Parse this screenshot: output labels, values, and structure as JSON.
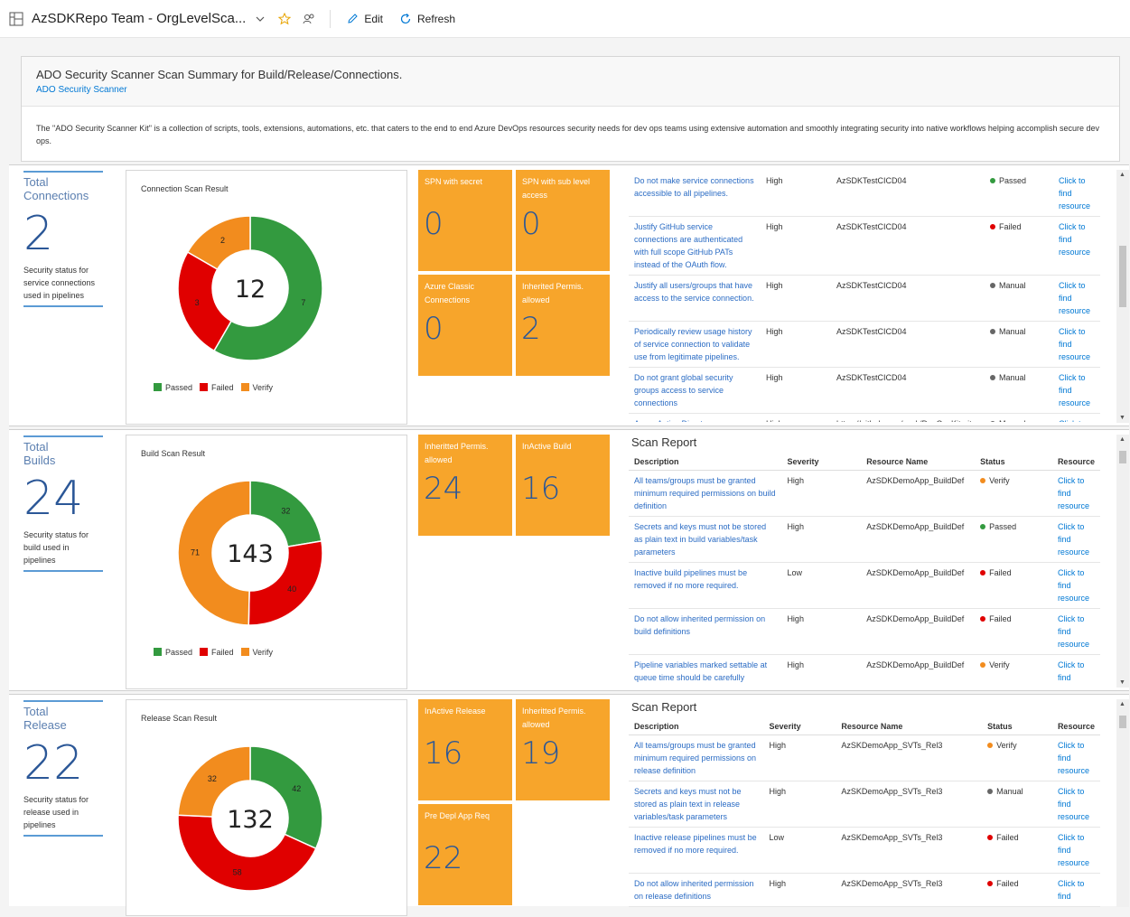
{
  "topbar": {
    "title": "AzSDKRepo Team - OrgLevelSca...",
    "edit_label": "Edit",
    "refresh_label": "Refresh"
  },
  "header": {
    "title": "ADO Security Scanner Scan Summary for Build/Release/Connections.",
    "link": "ADO Security Scanner",
    "description": "The \"ADO Security Scanner Kit\" is a collection of scripts, tools, extensions, automations, etc. that caters to the end to end Azure DevOps resources security needs for dev ops teams using extensive automation and smoothly integrating security into native workflows helping accomplish secure dev ops."
  },
  "colors": {
    "passed": "#339a3f",
    "failed": "#e00000",
    "verify": "#f28c1e",
    "manual": "#666666",
    "tile": "#f7a52b",
    "accent": "#2b5797"
  },
  "legend": {
    "passed": "Passed",
    "failed": "Failed",
    "verify": "Verify"
  },
  "connections": {
    "total_label_1": "Total",
    "total_label_2": "Connections",
    "total": "2",
    "sub": "Security status for service connections used in pipelines",
    "chart_title": "Connection Scan Result",
    "tiles": [
      {
        "label": "SPN with secret",
        "value": "0"
      },
      {
        "label": "SPN with sub level access",
        "value": "0"
      },
      {
        "label": "Azure Classic Connections",
        "value": "0"
      },
      {
        "label": "Inherited Permis. allowed",
        "value": "2"
      }
    ],
    "rows": [
      {
        "desc": "Do not make service connections accessible to all pipelines.",
        "severity": "High",
        "resource": "AzSDKTestCICD04",
        "status": "Passed",
        "status_color": "#339a3f",
        "link": "Click to find resource"
      },
      {
        "desc": "Justify GitHub service connections are authenticated with full scope GitHub PATs instead of the OAuth flow.",
        "severity": "High",
        "resource": "AzSDKTestCICD04",
        "status": "Failed",
        "status_color": "#e00000",
        "link": "Click to find resource"
      },
      {
        "desc": "Justify all users/groups that have access to the service connection.",
        "severity": "High",
        "resource": "AzSDKTestCICD04",
        "status": "Manual",
        "status_color": "#666666",
        "link": "Click to find resource"
      },
      {
        "desc": "Periodically review usage history of service connection to validate use from legitimate pipelines.",
        "severity": "High",
        "resource": "AzSDKTestCICD04",
        "status": "Manual",
        "status_color": "#666666",
        "link": "Click to find resource"
      },
      {
        "desc": "Do not grant global security groups access to service connections",
        "severity": "High",
        "resource": "AzSDKTestCICD04",
        "status": "Manual",
        "status_color": "#666666",
        "link": "Click to find resource"
      },
      {
        "desc": "Azure Active Directory",
        "severity": "High",
        "resource": "https://github.com/azsk/DevOpsKit.git",
        "status": "Manual",
        "status_color": "#666666",
        "link": "Click to"
      }
    ]
  },
  "builds": {
    "total_label_1": "Total",
    "total_label_2": "Builds",
    "total": "24",
    "sub": "Security status for build used in pipelines",
    "chart_title": "Build Scan Result",
    "tiles": [
      {
        "label": "Inheritted Permis. allowed",
        "value": "24"
      },
      {
        "label": "InActive Build",
        "value": "16"
      }
    ],
    "report_title": "Scan Report",
    "headers": [
      "Description",
      "Severity",
      "Resource Name",
      "Status",
      "Resource"
    ],
    "rows": [
      {
        "desc": "All teams/groups must be granted minimum required permissions on build definition",
        "severity": "High",
        "resource": "AzSDKDemoApp_BuildDef",
        "status": "Verify",
        "status_color": "#f28c1e",
        "link": "Click to find resource"
      },
      {
        "desc": "Secrets and keys must not be stored as plain text in build variables/task parameters",
        "severity": "High",
        "resource": "AzSDKDemoApp_BuildDef",
        "status": "Passed",
        "status_color": "#339a3f",
        "link": "Click to find resource"
      },
      {
        "desc": "Inactive build pipelines must be removed if no more required.",
        "severity": "Low",
        "resource": "AzSDKDemoApp_BuildDef",
        "status": "Failed",
        "status_color": "#e00000",
        "link": "Click to find resource"
      },
      {
        "desc": "Do not allow inherited permission on build definitions",
        "severity": "High",
        "resource": "AzSDKDemoApp_BuildDef",
        "status": "Failed",
        "status_color": "#e00000",
        "link": "Click to find resource"
      },
      {
        "desc": "Pipeline variables marked settable at queue time should be carefully reviewed.",
        "severity": "High",
        "resource": "AzSDKDemoApp_BuildDef",
        "status": "Verify",
        "status_color": "#f28c1e",
        "link": "Click to find resource"
      }
    ]
  },
  "releases": {
    "total_label_1": "Total",
    "total_label_2": "Release",
    "total": "22",
    "sub": "Security status for release used in pipelines",
    "chart_title": "Release Scan Result",
    "tiles": [
      {
        "label": "InActive Release",
        "value": "16"
      },
      {
        "label": "Inheritted Permis. allowed",
        "value": "19"
      },
      {
        "label": "Pre Depl App Req",
        "value": "22"
      }
    ],
    "report_title": "Scan Report",
    "headers": [
      "Description",
      "Severity",
      "Resource Name",
      "Status",
      "Resource"
    ],
    "rows": [
      {
        "desc": "All teams/groups must be granted minimum required permissions on release definition",
        "severity": "High",
        "resource": "AzSKDemoApp_SVTs_Rel3",
        "status": "Verify",
        "status_color": "#f28c1e",
        "link": "Click to find resource"
      },
      {
        "desc": "Secrets and keys must not be stored as plain text in release variables/task parameters",
        "severity": "High",
        "resource": "AzSKDemoApp_SVTs_Rel3",
        "status": "Manual",
        "status_color": "#666666",
        "link": "Click to find resource"
      },
      {
        "desc": "Inactive release pipelines must be removed if no more required.",
        "severity": "Low",
        "resource": "AzSKDemoApp_SVTs_Rel3",
        "status": "Failed",
        "status_color": "#e00000",
        "link": "Click to find resource"
      },
      {
        "desc": "Do not allow inherited permission on release definitions",
        "severity": "High",
        "resource": "AzSKDemoApp_SVTs_Rel3",
        "status": "Failed",
        "status_color": "#e00000",
        "link": "Click to find"
      }
    ]
  },
  "chart_data": [
    {
      "type": "pie",
      "title": "Connection Scan Result",
      "total_label": "12",
      "categories": [
        "Passed",
        "Failed",
        "Verify"
      ],
      "values": [
        7,
        3,
        2
      ],
      "colors": [
        "#339a3f",
        "#e00000",
        "#f28c1e"
      ],
      "legend_position": "bottom"
    },
    {
      "type": "pie",
      "title": "Build Scan Result",
      "total_label": "143",
      "categories": [
        "Passed",
        "Failed",
        "Verify"
      ],
      "values": [
        32,
        40,
        71
      ],
      "colors": [
        "#339a3f",
        "#e00000",
        "#f28c1e"
      ],
      "legend_position": "bottom"
    },
    {
      "type": "pie",
      "title": "Release Scan Result",
      "total_label": "132",
      "categories": [
        "Passed",
        "Failed",
        "Verify"
      ],
      "values": [
        42,
        58,
        32
      ],
      "colors": [
        "#339a3f",
        "#e00000",
        "#f28c1e"
      ],
      "legend_position": "bottom"
    }
  ]
}
